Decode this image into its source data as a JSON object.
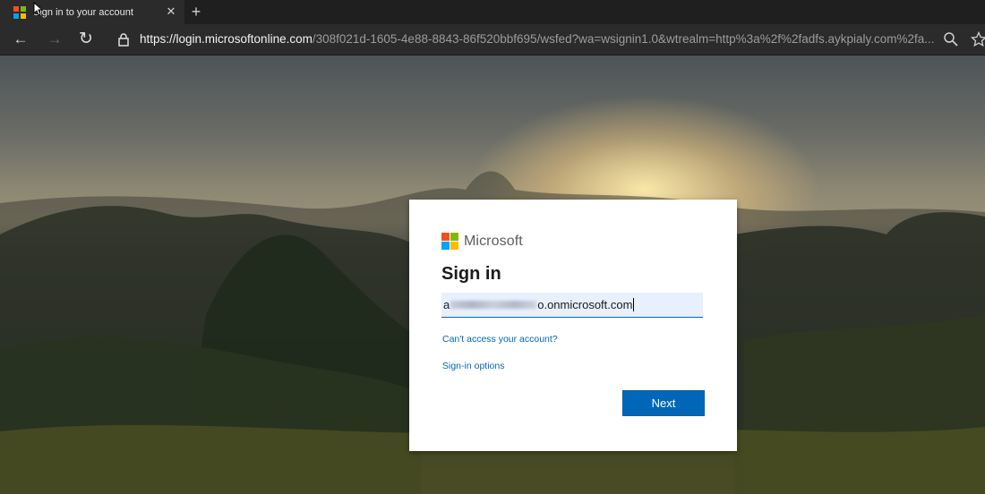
{
  "browser": {
    "tab": {
      "title": "Sign in to your account",
      "close_glyph": "✕",
      "favicon_colors": [
        "#f25022",
        "#7fba00",
        "#00a4ef",
        "#ffb900"
      ]
    },
    "new_tab_glyph": "+",
    "nav": {
      "back_glyph": "←",
      "forward_glyph": "→",
      "refresh_glyph": "↻"
    },
    "address": {
      "host": "https://login.microsoftonline.com",
      "path": "/308f021d-1605-4e88-8843-86f520bbf695/wsfed?wa=wsignin1.0&wtrealm=http%3a%2f%2fadfs.aykpialy.com%2fa..."
    },
    "icons": {
      "zoom": "search-icon",
      "favorite": "star-icon"
    }
  },
  "signin": {
    "brand_name": "Microsoft",
    "logo_colors": [
      "#f25022",
      "#7fba00",
      "#00a4ef",
      "#ffb900"
    ],
    "heading": "Sign in",
    "email_prefix": "a",
    "email_suffix": "o.onmicrosoft.com",
    "cant_access_link": "Can't access your account?",
    "options_link": "Sign-in options",
    "next_button": "Next",
    "accent_color": "#0067b8"
  }
}
